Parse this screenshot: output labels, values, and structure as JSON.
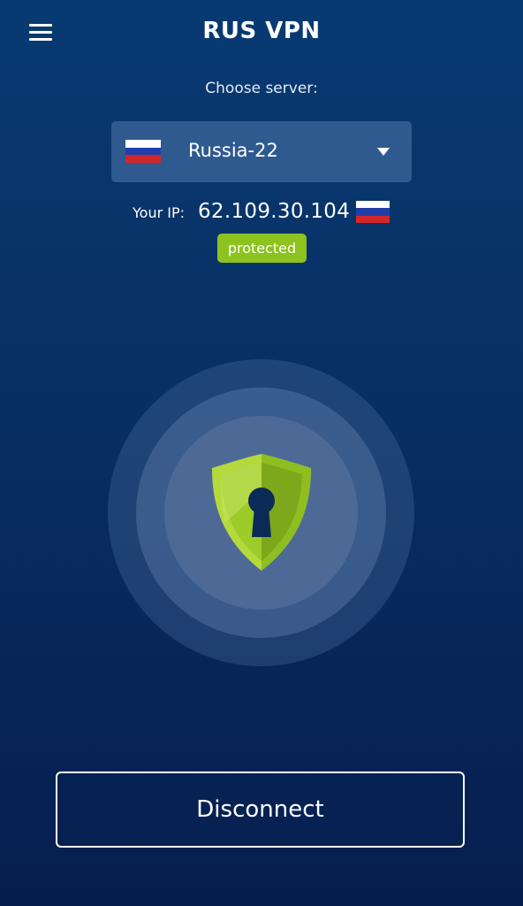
{
  "header": {
    "title": "RUS VPN",
    "menu_icon": "hamburger-menu-icon"
  },
  "server": {
    "choose_label": "Choose server:",
    "selected": "Russia-22",
    "flag_icon": "russia-flag-icon"
  },
  "connection": {
    "ip_label": "Your IP:",
    "ip_value": "62.109.30.104",
    "status": "protected"
  },
  "actions": {
    "disconnect_label": "Disconnect"
  },
  "colors": {
    "background_top": "#083a72",
    "background_bottom": "#061e4e",
    "accent_green": "#8dc21f",
    "select_bg": "#2e5a8f"
  }
}
